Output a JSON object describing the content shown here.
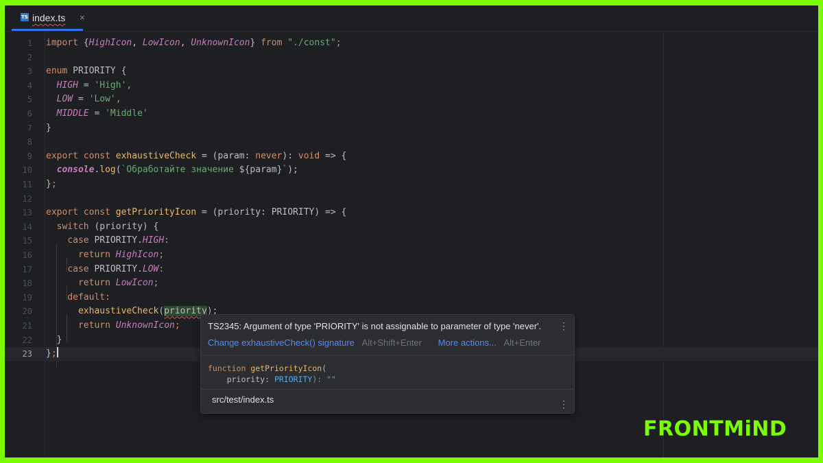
{
  "tab": {
    "label": "index.ts",
    "icon": "TS",
    "close": "×"
  },
  "lines": [
    {
      "n": "1",
      "tokens": [
        [
          "kw",
          "import "
        ],
        [
          "pun",
          "{"
        ],
        [
          "im",
          "HighIcon"
        ],
        [
          "pun",
          ", "
        ],
        [
          "im",
          "LowIcon"
        ],
        [
          "pun",
          ", "
        ],
        [
          "im",
          "UnknownIcon"
        ],
        [
          "pun",
          "} "
        ],
        [
          "kw",
          "from "
        ],
        [
          "str",
          "\"./const\""
        ],
        [
          "kw",
          ";"
        ]
      ]
    },
    {
      "n": "2",
      "tokens": []
    },
    {
      "n": "3",
      "tokens": [
        [
          "kw",
          "enum "
        ],
        [
          "pun",
          "PRIORITY {"
        ]
      ]
    },
    {
      "n": "4",
      "tokens": [
        [
          "pun",
          "  "
        ],
        [
          "en",
          "HIGH"
        ],
        [
          "pun",
          " = "
        ],
        [
          "str",
          "'High'"
        ],
        [
          "kw",
          ","
        ]
      ]
    },
    {
      "n": "5",
      "tokens": [
        [
          "pun",
          "  "
        ],
        [
          "en",
          "LOW"
        ],
        [
          "pun",
          " = "
        ],
        [
          "str",
          "'Low'"
        ],
        [
          "kw",
          ","
        ]
      ]
    },
    {
      "n": "6",
      "tokens": [
        [
          "pun",
          "  "
        ],
        [
          "en",
          "MIDDLE"
        ],
        [
          "pun",
          " = "
        ],
        [
          "str",
          "'Middle'"
        ]
      ]
    },
    {
      "n": "7",
      "tokens": [
        [
          "pun",
          "}"
        ]
      ]
    },
    {
      "n": "8",
      "tokens": []
    },
    {
      "n": "9",
      "tokens": [
        [
          "kw",
          "export const "
        ],
        [
          "fnd",
          "exhaustiveCheck"
        ],
        [
          "pun",
          " = (param: "
        ],
        [
          "kw",
          "never"
        ],
        [
          "pun",
          "): "
        ],
        [
          "kw",
          "void"
        ],
        [
          "pun",
          " => {"
        ]
      ]
    },
    {
      "n": "10",
      "tokens": [
        [
          "pun",
          "  "
        ],
        [
          "glob",
          "console"
        ],
        [
          "pun",
          "."
        ],
        [
          "fnd",
          "log"
        ],
        [
          "pun",
          "("
        ],
        [
          "str",
          "`Обработайте значение "
        ],
        [
          "pun",
          "${param}"
        ],
        [
          "str",
          "`"
        ],
        [
          "pun",
          ");"
        ]
      ]
    },
    {
      "n": "11",
      "tokens": [
        [
          "pun",
          "}"
        ],
        [
          "kw",
          ";"
        ]
      ]
    },
    {
      "n": "12",
      "tokens": []
    },
    {
      "n": "13",
      "tokens": [
        [
          "kw",
          "export const "
        ],
        [
          "fnd",
          "getPriorityIcon"
        ],
        [
          "pun",
          " = (priority: PRIORITY) => {"
        ]
      ]
    },
    {
      "n": "14",
      "tokens": [
        [
          "pun",
          "  "
        ],
        [
          "kw",
          "switch "
        ],
        [
          "pun",
          "(priority) {"
        ]
      ]
    },
    {
      "n": "15",
      "tokens": [
        [
          "pun",
          "    "
        ],
        [
          "kw",
          "case "
        ],
        [
          "pun",
          "PRIORITY."
        ],
        [
          "en",
          "HIGH"
        ],
        [
          "kw",
          ":"
        ]
      ]
    },
    {
      "n": "16",
      "tokens": [
        [
          "pun",
          "      "
        ],
        [
          "kw",
          "return "
        ],
        [
          "im",
          "HighIcon"
        ],
        [
          "kw",
          ";"
        ]
      ]
    },
    {
      "n": "17",
      "tokens": [
        [
          "pun",
          "    "
        ],
        [
          "kw",
          "case "
        ],
        [
          "pun",
          "PRIORITY."
        ],
        [
          "en",
          "LOW"
        ],
        [
          "kw",
          ":"
        ]
      ]
    },
    {
      "n": "18",
      "tokens": [
        [
          "pun",
          "      "
        ],
        [
          "kw",
          "return "
        ],
        [
          "im",
          "LowIcon"
        ],
        [
          "kw",
          ";"
        ]
      ]
    },
    {
      "n": "19",
      "tokens": [
        [
          "pun",
          "    "
        ],
        [
          "kw",
          "default"
        ],
        [
          "kw",
          ":"
        ]
      ]
    },
    {
      "n": "20",
      "tokens": [
        [
          "pun",
          "      "
        ],
        [
          "fnd",
          "exhaustiveCheck"
        ],
        [
          "pun",
          "("
        ],
        [
          "err",
          "priority"
        ],
        [
          "pun",
          ");"
        ]
      ]
    },
    {
      "n": "21",
      "tokens": [
        [
          "pun",
          "      "
        ],
        [
          "kw",
          "return "
        ],
        [
          "im",
          "UnknownIcon"
        ],
        [
          "kw",
          ";"
        ]
      ]
    },
    {
      "n": "22",
      "tokens": [
        [
          "pun",
          "  }"
        ]
      ]
    },
    {
      "n": "23",
      "tokens": [
        [
          "pun",
          "}"
        ],
        [
          "kw",
          ";"
        ]
      ],
      "current": true
    }
  ],
  "popup": {
    "message": "TS2345: Argument of type 'PRIORITY' is not assignable to parameter of type 'never'.",
    "action1": "Change exhaustiveCheck() signature",
    "action1_shortcut": "Alt+Shift+Enter",
    "action2": "More actions...",
    "action2_shortcut": "Alt+Enter",
    "sig_keyword": "function",
    "sig_name": "getPriorityIcon",
    "sig_paren": "(",
    "sig_param": "    priority: ",
    "sig_type": "PRIORITY",
    "sig_tail": "): \"\"",
    "path": "src/test/index.ts",
    "more": "⋮"
  },
  "logo": "FRONTMiND",
  "colors": {
    "accent": "#3574F0",
    "brand": "#7CFC00",
    "background": "#1E1F22"
  }
}
